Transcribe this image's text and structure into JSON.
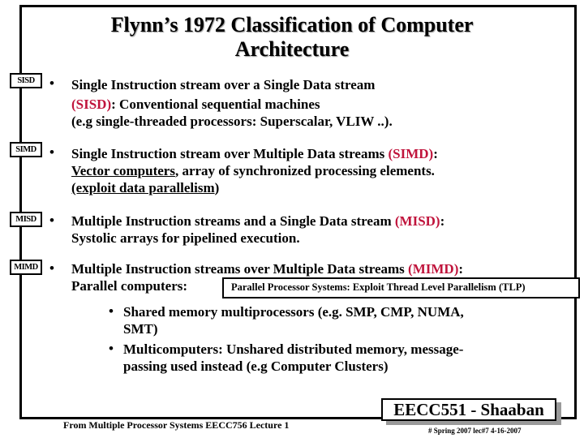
{
  "title": {
    "line1": "Flynn’s 1972 Classification of Computer",
    "line2": "Architecture"
  },
  "accent_color": "#c0143c",
  "items": [
    {
      "label": "SISD",
      "line1": "Single Instruction stream over a Single Data stream",
      "line2_tag": "(SISD)",
      "line2_rest": ":  Conventional sequential machines",
      "line3": "(e.g single-threaded processors: Superscalar, VLIW ..)."
    },
    {
      "label": "SIMD",
      "line1_pre": "Single Instruction stream over Multiple Data streams ",
      "line1_tag": "(SIMD)",
      "line1_post": ":",
      "line2_ul": "Vector computers",
      "line2_rest": ", array of synchronized  processing elements.",
      "line3_ul": "(exploit data parallelism",
      "line3_post": ")"
    },
    {
      "label": "MISD",
      "line1_pre": "Multiple Instruction streams and a Single Data stream ",
      "line1_tag": "(MISD)",
      "line1_post": ":",
      "line2": "Systolic arrays for pipelined execution."
    },
    {
      "label": "MIMD",
      "line1_pre": "Multiple Instruction streams over Multiple Data streams ",
      "line1_tag": "(MIMD)",
      "line1_post": ":",
      "line2": "Parallel computers:",
      "note": "Parallel Processor Systems:   Exploit Thread Level Parallelism (TLP)",
      "sub_bullets": [
        {
          "line1": "Shared memory multiprocessors (e.g. SMP, CMP, NUMA,",
          "line2": "SMT)"
        },
        {
          "line1": "Multicomputers:  Unshared distributed memory, message-",
          "line2": "passing used instead (e.g Computer Clusters)"
        }
      ]
    }
  ],
  "bullet_glyph": "•",
  "footer": {
    "source": "From Multiple Processor Systems EECC756 Lecture 1",
    "course": "EECC551 - Shaaban",
    "meta": "#   Spring 2007  lec#7    4-16-2007"
  }
}
